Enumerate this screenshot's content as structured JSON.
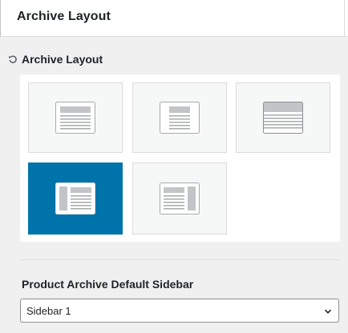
{
  "header": {
    "title": "Archive Layout"
  },
  "archive_layout": {
    "label": "Archive Layout",
    "reset_icon": "reset-icon",
    "options": [
      {
        "name": "layout-option-full-width",
        "icon": "layout-full-width-icon",
        "selected": false
      },
      {
        "name": "layout-option-narrow",
        "icon": "layout-narrow-icon",
        "selected": false
      },
      {
        "name": "layout-option-stretched",
        "icon": "layout-stretched-icon",
        "selected": false
      },
      {
        "name": "layout-option-left-sidebar",
        "icon": "layout-left-sidebar-icon",
        "selected": true
      },
      {
        "name": "layout-option-right-sidebar",
        "icon": "layout-right-sidebar-icon",
        "selected": false
      }
    ]
  },
  "sidebar_select": {
    "label": "Product Archive Default Sidebar",
    "value": "Sidebar 1",
    "icon": "chevron-down-icon"
  },
  "colors": {
    "accent": "#0073aa",
    "panel_bg": "#f0f0f1",
    "option_bg": "#f6f7f7",
    "border": "#dcdcde"
  }
}
